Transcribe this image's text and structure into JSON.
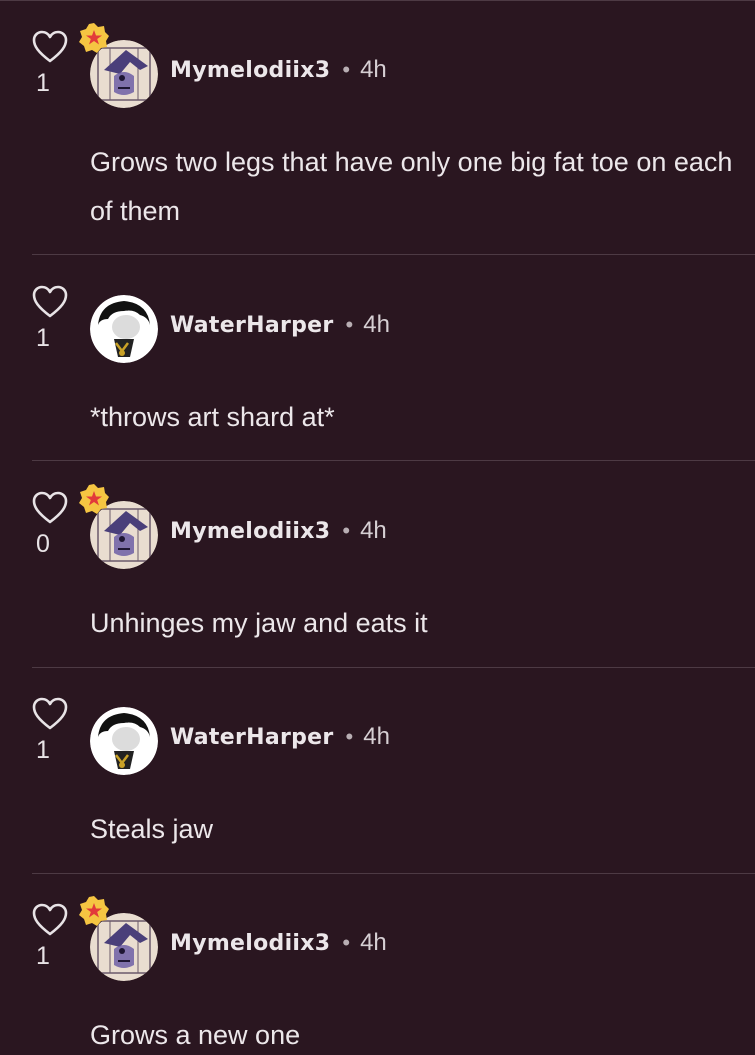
{
  "colors": {
    "background": "#2a1620",
    "text": "#ece7ea",
    "divider": "#4d3a44",
    "badge": "#f5c542",
    "badge_star": "#e23a3a"
  },
  "comments": [
    {
      "likes": "1",
      "username": "Mymelodiix3",
      "separator": "•",
      "time": "4h",
      "has_badge": true,
      "avatar": "mymelody-avatar",
      "body": "Grows two legs that have only one big fat toe on each of them"
    },
    {
      "likes": "1",
      "username": "WaterHarper",
      "separator": "•",
      "time": "4h",
      "has_badge": false,
      "avatar": "waterharper-avatar",
      "body": "*throws art shard at*"
    },
    {
      "likes": "0",
      "username": "Mymelodiix3",
      "separator": "•",
      "time": "4h",
      "has_badge": true,
      "avatar": "mymelody-avatar",
      "body": "Unhinges my jaw and eats it"
    },
    {
      "likes": "1",
      "username": "WaterHarper",
      "separator": "•",
      "time": "4h",
      "has_badge": false,
      "avatar": "waterharper-avatar",
      "body": "Steals jaw"
    },
    {
      "likes": "1",
      "username": "Mymelodiix3",
      "separator": "•",
      "time": "4h",
      "has_badge": true,
      "avatar": "mymelody-avatar",
      "body": "Grows a new one"
    }
  ]
}
